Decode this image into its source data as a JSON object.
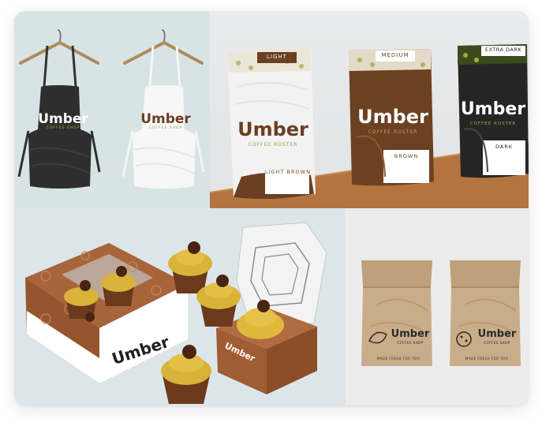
{
  "brand": {
    "name": "Umber",
    "tagline_shop": "COFFEE SHOP",
    "tagline_roaster": "COFFEE ROSTER",
    "bag_slogan": "MADE FRESH FOR YOU"
  },
  "pouches": [
    {
      "top_label": "LIGHT",
      "bottom_label": "LIGHT BROWN"
    },
    {
      "top_label": "MEDIUM",
      "bottom_label": "BROWN"
    },
    {
      "top_label": "EXTRA DARK",
      "bottom_label": "DARK"
    }
  ],
  "colors": {
    "coffee": "#6b3f22",
    "caramel": "#a8643a",
    "green": "#8fa23a",
    "black": "#2a2a2a",
    "kraft": "#c9ad8a"
  }
}
